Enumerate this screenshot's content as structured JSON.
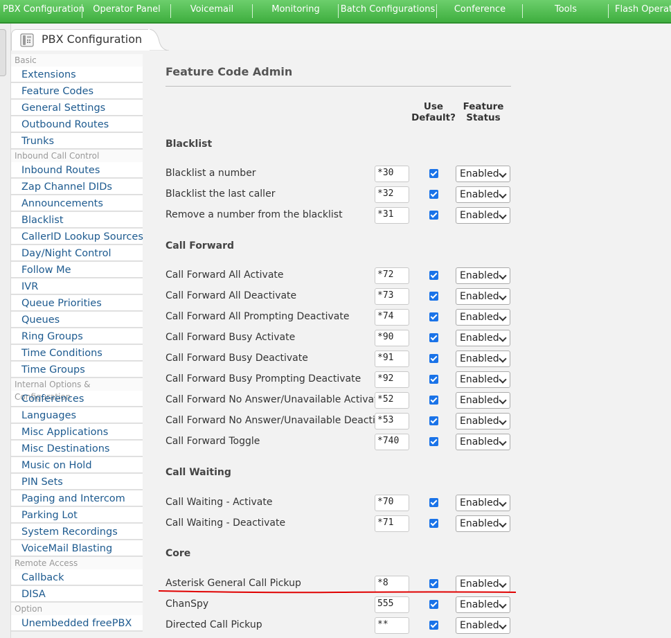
{
  "top_menu": [
    "PBX Configuration",
    "Operator Panel",
    "Voicemail",
    "Monitoring",
    "Batch Configurations",
    "Conference",
    "Tools",
    "Flash Operator"
  ],
  "tab": {
    "title": "PBX Configuration",
    "icon": "phone-icon"
  },
  "sidebar": {
    "sections": [
      {
        "title": "Basic",
        "items": [
          "Extensions",
          "Feature Codes",
          "General Settings",
          "Outbound Routes",
          "Trunks"
        ]
      },
      {
        "title": "Inbound Call Control",
        "items": [
          "Inbound Routes",
          "Zap Channel DIDs",
          "Announcements",
          "Blacklist",
          "CallerID Lookup Sources",
          "Day/Night Control",
          "Follow Me",
          "IVR",
          "Queue Priorities",
          "Queues",
          "Ring Groups",
          "Time Conditions",
          "Time Groups"
        ]
      },
      {
        "title": "Internal Options & Configuration",
        "items": [
          "Conferences",
          "Languages",
          "Misc Applications",
          "Misc Destinations",
          "Music on Hold",
          "PIN Sets",
          "Paging and Intercom",
          "Parking Lot",
          "System Recordings",
          "VoiceMail Blasting"
        ]
      },
      {
        "title": "Remote Access",
        "items": [
          "Callback",
          "DISA"
        ]
      },
      {
        "title": "Option",
        "items": [
          "Unembedded freePBX"
        ]
      }
    ]
  },
  "main": {
    "title": "Feature Code Admin",
    "col_use_default": [
      "Use",
      "Default?"
    ],
    "col_feature_status": [
      "Feature",
      "Status"
    ],
    "groups": [
      {
        "title": "Blacklist",
        "rows": [
          {
            "label": "Blacklist a number",
            "code": "*30",
            "use_default": true,
            "status": "Enabled"
          },
          {
            "label": "Blacklist the last caller",
            "code": "*32",
            "use_default": true,
            "status": "Enabled"
          },
          {
            "label": "Remove a number from the blacklist",
            "code": "*31",
            "use_default": true,
            "status": "Enabled"
          }
        ]
      },
      {
        "title": "Call Forward",
        "rows": [
          {
            "label": "Call Forward All Activate",
            "code": "*72",
            "use_default": true,
            "status": "Enabled"
          },
          {
            "label": "Call Forward All Deactivate",
            "code": "*73",
            "use_default": true,
            "status": "Enabled"
          },
          {
            "label": "Call Forward All Prompting Deactivate",
            "code": "*74",
            "use_default": true,
            "status": "Enabled"
          },
          {
            "label": "Call Forward Busy Activate",
            "code": "*90",
            "use_default": true,
            "status": "Enabled"
          },
          {
            "label": "Call Forward Busy Deactivate",
            "code": "*91",
            "use_default": true,
            "status": "Enabled"
          },
          {
            "label": "Call Forward Busy Prompting Deactivate",
            "code": "*92",
            "use_default": true,
            "status": "Enabled"
          },
          {
            "label": "Call Forward No Answer/Unavailable Activate",
            "code": "*52",
            "use_default": true,
            "status": "Enabled"
          },
          {
            "label": "Call Forward No Answer/Unavailable Deactivate",
            "code": "*53",
            "use_default": true,
            "status": "Enabled"
          },
          {
            "label": "Call Forward Toggle",
            "code": "*740",
            "use_default": true,
            "status": "Enabled"
          }
        ]
      },
      {
        "title": "Call Waiting",
        "rows": [
          {
            "label": "Call Waiting - Activate",
            "code": "*70",
            "use_default": true,
            "status": "Enabled"
          },
          {
            "label": "Call Waiting - Deactivate",
            "code": "*71",
            "use_default": true,
            "status": "Enabled"
          }
        ]
      },
      {
        "title": "Core",
        "rows": [
          {
            "label": "Asterisk General Call Pickup",
            "code": "*8",
            "use_default": true,
            "status": "Enabled",
            "highlighted": true
          },
          {
            "label": "ChanSpy",
            "code": "555",
            "use_default": true,
            "status": "Enabled"
          },
          {
            "label": "Directed Call Pickup",
            "code": "**",
            "use_default": true,
            "status": "Enabled"
          }
        ]
      }
    ]
  },
  "colors": {
    "menu_green": "#4cbf4c",
    "link_blue": "#1d5a8f",
    "checkbox_blue": "#1a73e8",
    "annotation_red": "#e00000"
  }
}
